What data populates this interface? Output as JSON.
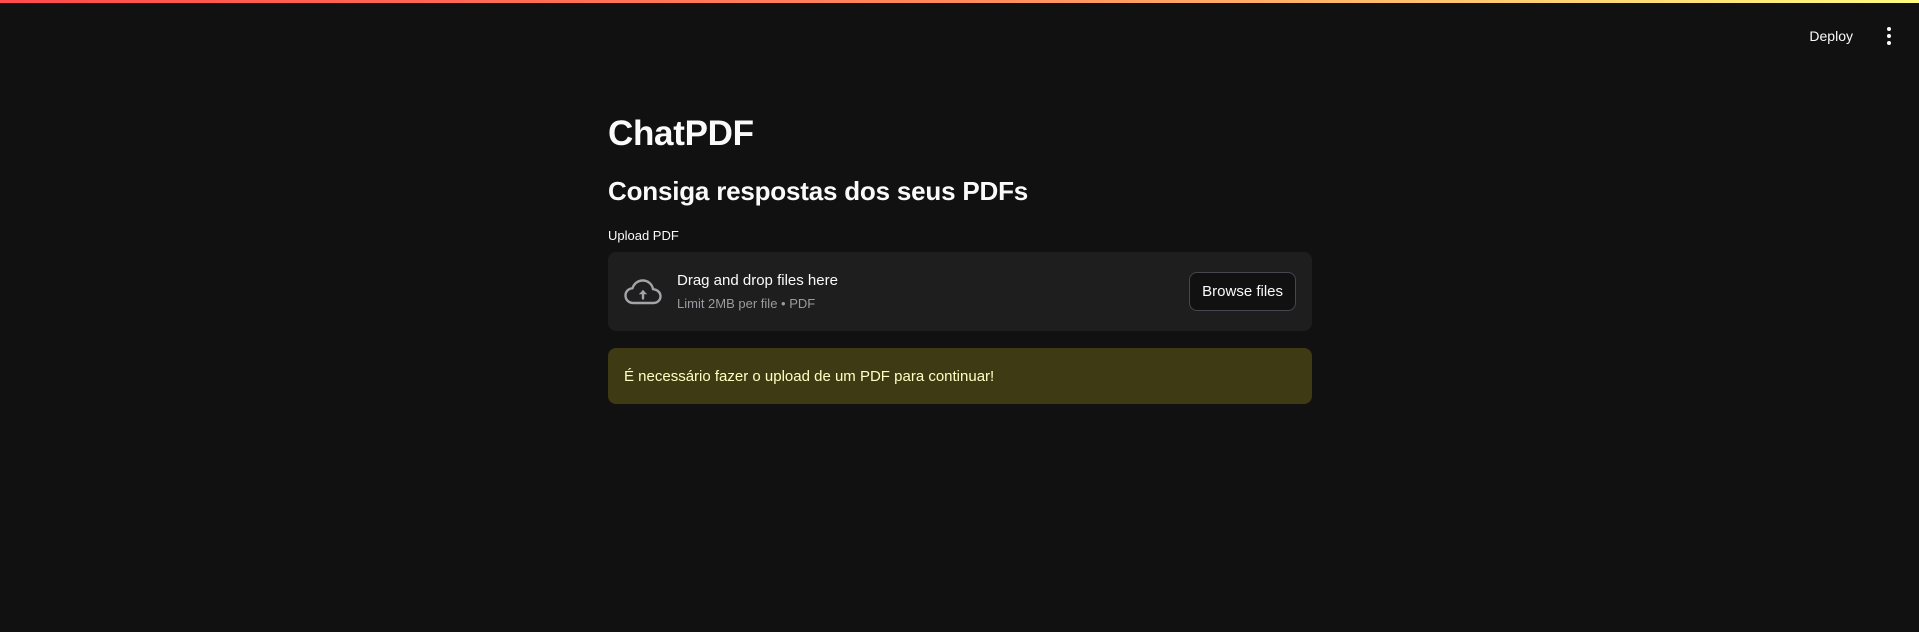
{
  "header": {
    "deploy_label": "Deploy",
    "menu_icon": "kebab-menu-icon"
  },
  "main": {
    "title": "ChatPDF",
    "subtitle": "Consiga respostas dos seus PDFs",
    "uploader": {
      "label": "Upload PDF",
      "drop_text": "Drag and drop files here",
      "limit_text": "Limit 2MB per file • PDF",
      "browse_label": "Browse files",
      "icon": "cloud-upload-icon"
    },
    "warning": {
      "text": "É necessário fazer o upload de um PDF para continuar!"
    }
  },
  "colors": {
    "background": "#111111",
    "dropzone": "#1e1e1e",
    "warning_bg": "#3e3a14",
    "warning_text": "#ffffc2",
    "top_gradient": [
      "#ff4b4b",
      "#fffd80"
    ]
  }
}
